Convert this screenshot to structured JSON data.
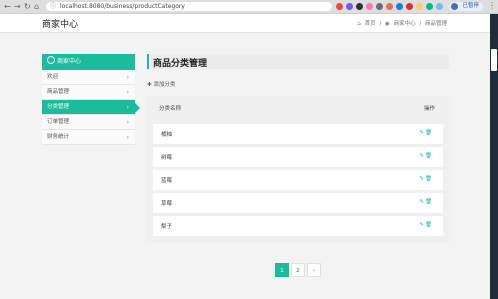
{
  "browser": {
    "url": "localhost:8080/business/productCategory",
    "profile_label": "已暂停"
  },
  "header": {
    "app_title": "商家中心",
    "breadcrumb": [
      "首页",
      "商家中心",
      "商品管理"
    ],
    "breadcrumb_sep": "/"
  },
  "sidebar": {
    "title": "商家中心",
    "items": [
      {
        "label": "欢迎"
      },
      {
        "label": "商品管理"
      },
      {
        "label": "分类管理",
        "active": true
      },
      {
        "label": "订单管理"
      },
      {
        "label": "财务统计"
      }
    ]
  },
  "main": {
    "title": "商品分类管理",
    "add_label": "添加分类",
    "columns": {
      "name": "分类名称",
      "ops": "操作"
    },
    "rows": [
      {
        "name": "橘柚"
      },
      {
        "name": "树莓"
      },
      {
        "name": "蓝莓"
      },
      {
        "name": "草莓"
      },
      {
        "name": "梨子"
      }
    ]
  },
  "pagination": {
    "pages": [
      "1",
      "2"
    ],
    "current": "1",
    "next": "›"
  },
  "colors": {
    "accent": "#1abc9c",
    "sidebar_bg": "#fafafa",
    "page_bg": "#f3f3f3"
  }
}
